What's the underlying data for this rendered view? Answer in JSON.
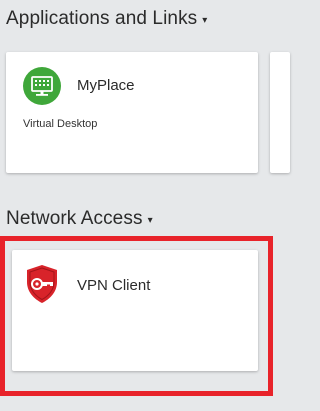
{
  "sections": {
    "apps": {
      "title": "Applications and Links",
      "caret": "▾"
    },
    "network": {
      "title": "Network Access",
      "caret": "▾"
    }
  },
  "tiles": {
    "myplace": {
      "name": "MyPlace",
      "subtitle": "Virtual Desktop",
      "icon": "virtual-desktop-icon"
    },
    "vpn": {
      "name": "VPN Client",
      "icon": "vpn-shield-icon"
    }
  },
  "colors": {
    "background": "#e6e8ea",
    "desktop_icon_green": "#3fa73a",
    "vpn_shield_red": "#d8232a",
    "highlight_red": "#e8232a"
  }
}
